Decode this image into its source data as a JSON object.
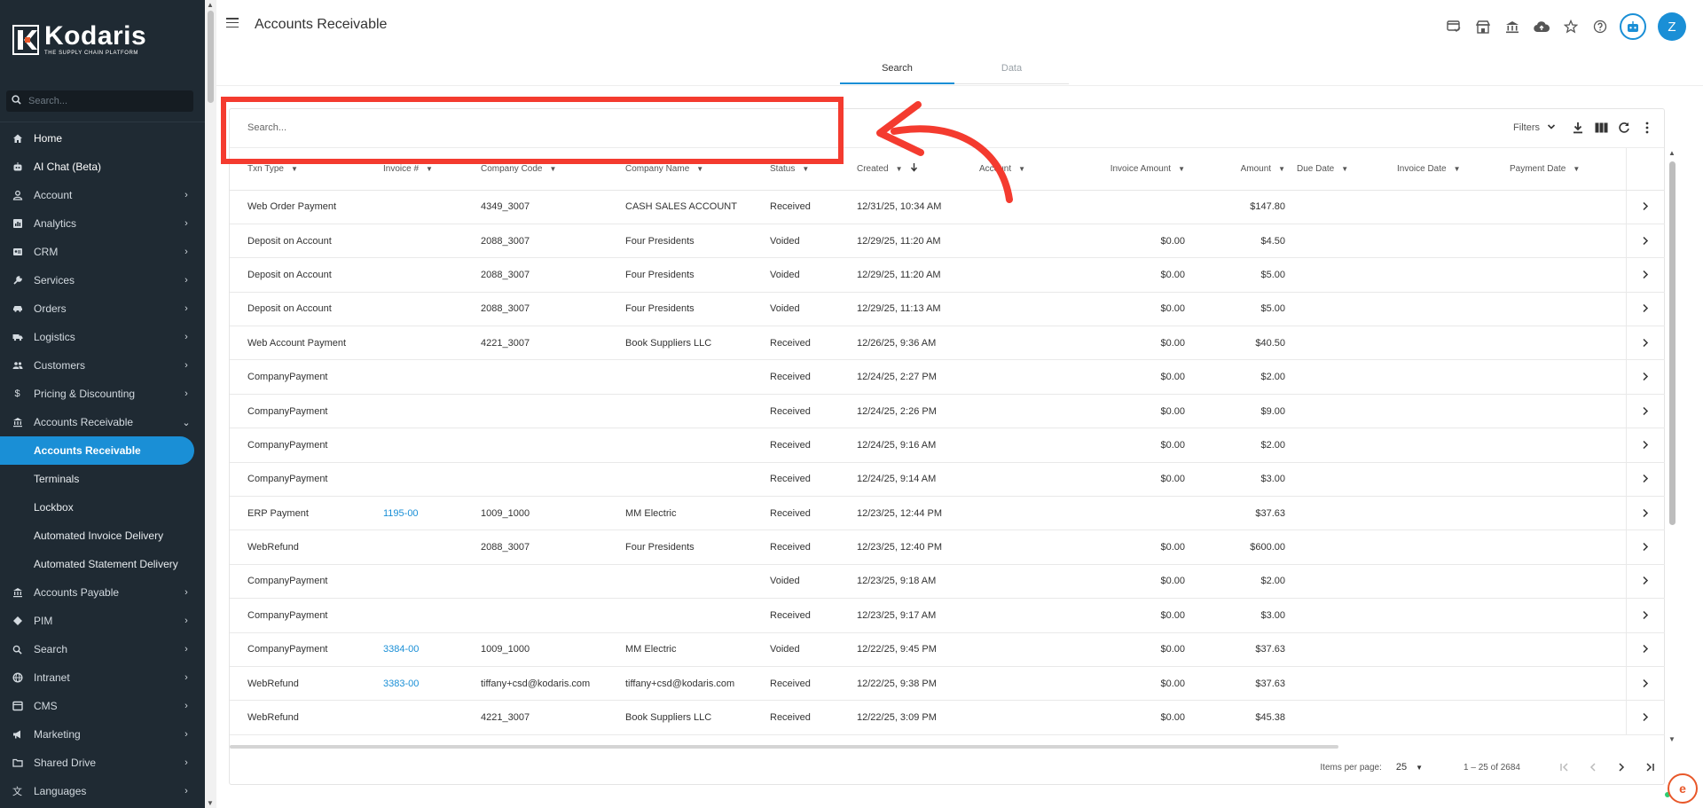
{
  "app": {
    "logo_name": "Kodaris",
    "logo_tagline": "THE SUPPLY CHAIN PLATFORM",
    "brand_color": "#1a8fd6"
  },
  "sidebar": {
    "search_placeholder": "Search...",
    "items": [
      {
        "label": "Home",
        "icon": "home-icon",
        "chevron": ""
      },
      {
        "label": "AI Chat (Beta)",
        "icon": "robot-icon",
        "chevron": ""
      },
      {
        "label": "Account",
        "icon": "person-icon",
        "chevron": "›"
      },
      {
        "label": "Analytics",
        "icon": "chart-icon",
        "chevron": "›"
      },
      {
        "label": "CRM",
        "icon": "contact-card-icon",
        "chevron": "›"
      },
      {
        "label": "Services",
        "icon": "wrench-icon",
        "chevron": "›"
      },
      {
        "label": "Orders",
        "icon": "truck-icon",
        "chevron": "›"
      },
      {
        "label": "Logistics",
        "icon": "truck-icon",
        "chevron": "›"
      },
      {
        "label": "Customers",
        "icon": "people-icon",
        "chevron": "›"
      },
      {
        "label": "Pricing & Discounting",
        "icon": "dollar-icon",
        "chevron": "›"
      },
      {
        "label": "Accounts Receivable",
        "icon": "bank-icon",
        "chevron": "⌄"
      }
    ],
    "sub_items": [
      {
        "label": "Accounts Receivable",
        "active": true
      },
      {
        "label": "Terminals",
        "active": false
      },
      {
        "label": "Lockbox",
        "active": false
      },
      {
        "label": "Automated Invoice Delivery",
        "active": false
      },
      {
        "label": "Automated Statement Delivery",
        "active": false
      }
    ],
    "items_after": [
      {
        "label": "Accounts Payable",
        "icon": "bank-icon",
        "chevron": "›"
      },
      {
        "label": "PIM",
        "icon": "diamond-icon",
        "chevron": "›"
      },
      {
        "label": "Search",
        "icon": "search-icon",
        "chevron": "›"
      },
      {
        "label": "Intranet",
        "icon": "globe-icon",
        "chevron": "›"
      },
      {
        "label": "CMS",
        "icon": "layout-icon",
        "chevron": "›"
      },
      {
        "label": "Marketing",
        "icon": "megaphone-icon",
        "chevron": "›"
      },
      {
        "label": "Shared Drive",
        "icon": "folder-icon",
        "chevron": "›"
      },
      {
        "label": "Languages",
        "icon": "translate-icon",
        "chevron": "›"
      }
    ]
  },
  "header": {
    "title": "Accounts Receivable",
    "avatar_initial": "Z",
    "icons": [
      "card-check-icon",
      "storefront-icon",
      "bank-icon",
      "cloud-upload-icon",
      "star-icon",
      "help-icon",
      "bot-icon"
    ]
  },
  "tabs": [
    {
      "label": "Search",
      "active": true
    },
    {
      "label": "Data",
      "active": false
    }
  ],
  "toolbar": {
    "search_placeholder": "Search...",
    "filters_label": "Filters"
  },
  "table": {
    "columns": [
      "Txn Type",
      "Invoice #",
      "Company Code",
      "Company Name",
      "Status",
      "Created",
      "Account",
      "Invoice Amount",
      "Amount",
      "Due Date",
      "Invoice Date",
      "Payment Date"
    ],
    "rows": [
      [
        "Web Order Payment",
        "",
        "4349_3007",
        "CASH SALES ACCOUNT",
        "Received",
        "12/31/25, 10:34 AM",
        "",
        "",
        "$147.80",
        "",
        "",
        ""
      ],
      [
        "Deposit on Account",
        "",
        "2088_3007",
        "Four Presidents",
        "Voided",
        "12/29/25, 11:20 AM",
        "",
        "$0.00",
        "$4.50",
        "",
        "",
        ""
      ],
      [
        "Deposit on Account",
        "",
        "2088_3007",
        "Four Presidents",
        "Voided",
        "12/29/25, 11:20 AM",
        "",
        "$0.00",
        "$5.00",
        "",
        "",
        ""
      ],
      [
        "Deposit on Account",
        "",
        "2088_3007",
        "Four Presidents",
        "Voided",
        "12/29/25, 11:13 AM",
        "",
        "$0.00",
        "$5.00",
        "",
        "",
        ""
      ],
      [
        "Web Account Payment",
        "",
        "4221_3007",
        "Book Suppliers LLC",
        "Received",
        "12/26/25, 9:36 AM",
        "",
        "$0.00",
        "$40.50",
        "",
        "",
        ""
      ],
      [
        "CompanyPayment",
        "",
        "",
        "",
        "Received",
        "12/24/25, 2:27 PM",
        "",
        "$0.00",
        "$2.00",
        "",
        "",
        ""
      ],
      [
        "CompanyPayment",
        "",
        "",
        "",
        "Received",
        "12/24/25, 2:26 PM",
        "",
        "$0.00",
        "$9.00",
        "",
        "",
        ""
      ],
      [
        "CompanyPayment",
        "",
        "",
        "",
        "Received",
        "12/24/25, 9:16 AM",
        "",
        "$0.00",
        "$2.00",
        "",
        "",
        ""
      ],
      [
        "CompanyPayment",
        "",
        "",
        "",
        "Received",
        "12/24/25, 9:14 AM",
        "",
        "$0.00",
        "$3.00",
        "",
        "",
        ""
      ],
      [
        "ERP Payment",
        "1195-00",
        "1009_1000",
        "MM Electric",
        "Received",
        "12/23/25, 12:44 PM",
        "",
        "",
        "$37.63",
        "",
        "",
        ""
      ],
      [
        "WebRefund",
        "",
        "2088_3007",
        "Four Presidents",
        "Received",
        "12/23/25, 12:40 PM",
        "",
        "$0.00",
        "$600.00",
        "",
        "",
        ""
      ],
      [
        "CompanyPayment",
        "",
        "",
        "",
        "Voided",
        "12/23/25, 9:18 AM",
        "",
        "$0.00",
        "$2.00",
        "",
        "",
        ""
      ],
      [
        "CompanyPayment",
        "",
        "",
        "",
        "Received",
        "12/23/25, 9:17 AM",
        "",
        "$0.00",
        "$3.00",
        "",
        "",
        ""
      ],
      [
        "CompanyPayment",
        "3384-00",
        "1009_1000",
        "MM Electric",
        "Voided",
        "12/22/25, 9:45 PM",
        "",
        "$0.00",
        "$37.63",
        "",
        "",
        ""
      ],
      [
        "WebRefund",
        "3383-00",
        "tiffany+csd@kodaris.com",
        "tiffany+csd@kodaris.com",
        "Received",
        "12/22/25, 9:38 PM",
        "",
        "$0.00",
        "$37.63",
        "",
        "",
        ""
      ],
      [
        "WebRefund",
        "",
        "4221_3007",
        "Book Suppliers LLC",
        "Received",
        "12/22/25, 3:09 PM",
        "",
        "$0.00",
        "$45.38",
        "",
        "",
        ""
      ]
    ]
  },
  "paginator": {
    "items_per_page_label": "Items per page:",
    "page_size": "25",
    "range_label": "1 – 25 of 2684"
  },
  "annotation_color": "#f43b2f"
}
